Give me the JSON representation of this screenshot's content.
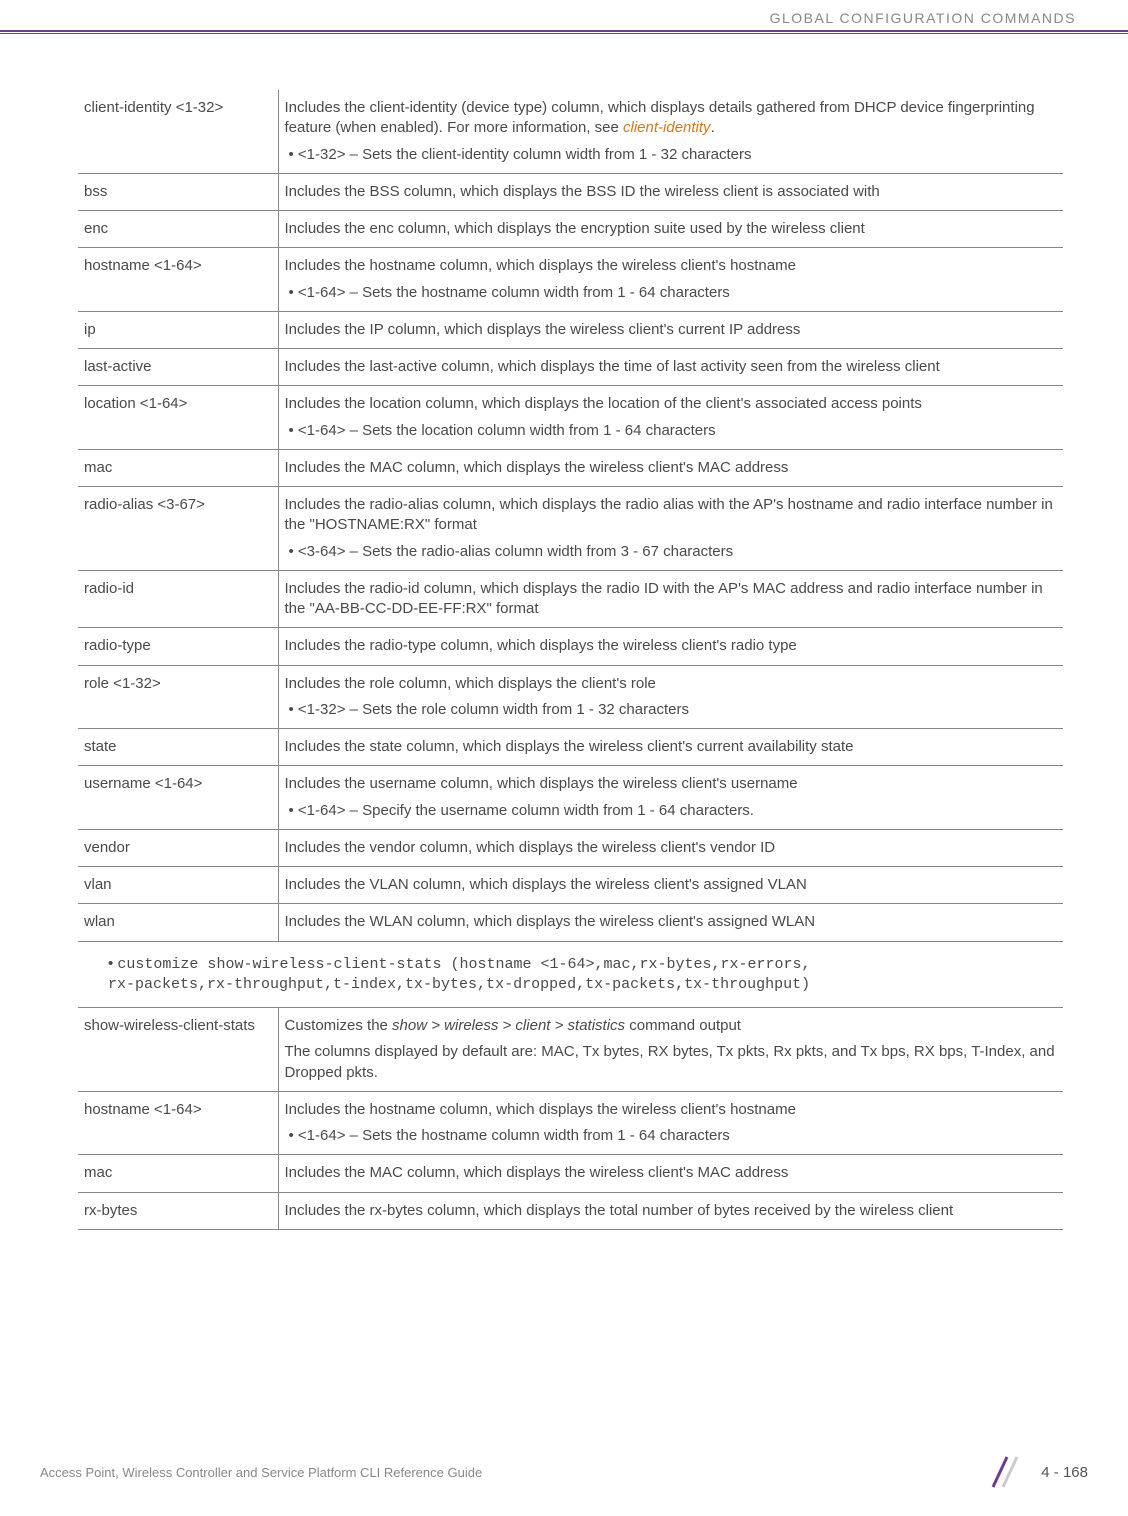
{
  "header": "GLOBAL CONFIGURATION COMMANDS",
  "table1": {
    "rows": [
      {
        "param": "client-identity <1-32>",
        "desc_main": "Includes the client-identity (device type) column, which displays details gathered from DHCP device fingerprinting feature (when enabled). For more information, see ",
        "desc_link": "client-identity",
        "desc_after": ".",
        "bullet": "<1-32> – Sets the client-identity column width from 1 - 32 characters"
      },
      {
        "param": "bss",
        "desc_main": "Includes the BSS column, which displays the BSS ID the wireless client is associated with"
      },
      {
        "param": "enc",
        "desc_main": "Includes the enc column, which displays the encryption suite used by the wireless client"
      },
      {
        "param": "hostname <1-64>",
        "desc_main": "Includes the hostname column, which displays the wireless client's hostname",
        "bullet": "<1-64> – Sets the hostname column width from 1 - 64 characters"
      },
      {
        "param": "ip",
        "desc_main": "Includes the IP column, which displays the wireless client's current IP address"
      },
      {
        "param": "last-active",
        "desc_main": "Includes the last-active column, which displays the time of last activity seen from the wireless client"
      },
      {
        "param": "location <1-64>",
        "desc_main": "Includes the location column, which displays the location of the client's associated access points",
        "bullet": "<1-64> – Sets the location column width from 1 - 64 characters"
      },
      {
        "param": "mac",
        "desc_main": "Includes the MAC column, which displays the wireless client's MAC address"
      },
      {
        "param": "radio-alias <3-67>",
        "desc_main": "Includes the radio-alias column, which displays the radio alias with the AP's hostname and radio interface number in the \"HOSTNAME:RX\" format",
        "bullet": "<3-64> – Sets the radio-alias column width from 3 - 67 characters"
      },
      {
        "param": "radio-id",
        "desc_main": "Includes the radio-id column, which displays the radio ID with the AP's MAC address and radio interface number in the \"AA-BB-CC-DD-EE-FF:RX\" format"
      },
      {
        "param": "radio-type",
        "desc_main": "Includes the radio-type column, which displays the wireless client's radio type"
      },
      {
        "param": "role <1-32>",
        "desc_main": "Includes the role column, which displays the client's role",
        "bullet": "<1-32> – Sets the role column width from 1 - 32 characters"
      },
      {
        "param": "state",
        "desc_main": "Includes the state column, which displays the wireless client's current availability state"
      },
      {
        "param": "username <1-64>",
        "desc_main": "Includes the username column, which displays the wireless client's username",
        "bullet": "<1-64> – Specify the username column width from 1 - 64 characters."
      },
      {
        "param": "vendor",
        "desc_main": "Includes the vendor column, which displays the wireless client's vendor ID"
      },
      {
        "param": "vlan",
        "desc_main": "Includes the VLAN column, which displays the wireless client's assigned VLAN"
      },
      {
        "param": "wlan",
        "desc_main": "Includes the WLAN column, which displays the wireless client's assigned WLAN"
      }
    ]
  },
  "mono": {
    "line1": "customize show-wireless-client-stats (hostname <1-64>,mac,rx-bytes,rx-errors,",
    "line2": "rx-packets,rx-throughput,t-index,tx-bytes,tx-dropped,tx-packets,tx-throughput)"
  },
  "table2": {
    "rows": [
      {
        "param": "show-wireless-client-stats",
        "desc_main_pre": "Customizes the ",
        "desc_italic": "show > wireless > client > statistics",
        "desc_main_post": " command output",
        "desc_line2": "The columns displayed by default are: MAC, Tx bytes, RX bytes, Tx pkts, Rx pkts, and Tx bps, RX bps, T-Index, and Dropped pkts."
      },
      {
        "param": "hostname <1-64>",
        "desc_main": "Includes the hostname column, which displays the wireless client's hostname",
        "bullet": "<1-64> – Sets the hostname column width from 1 - 64 characters"
      },
      {
        "param": "mac",
        "desc_main": "Includes the MAC column, which displays the wireless client's MAC address"
      },
      {
        "param": "rx-bytes",
        "desc_main": "Includes the rx-bytes column, which displays the total number of bytes received by the wireless client"
      }
    ]
  },
  "footer": {
    "text": "Access Point, Wireless Controller and Service Platform CLI Reference Guide",
    "page": "4 - 168"
  }
}
